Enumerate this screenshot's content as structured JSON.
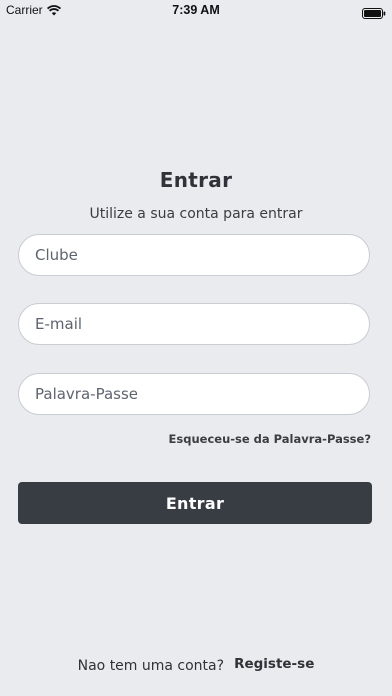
{
  "status_bar": {
    "carrier": "Carrier",
    "time": "7:39 AM",
    "icons": [
      "wifi-icon",
      "battery-icon"
    ]
  },
  "login": {
    "title": "Entrar",
    "subtitle": "Utilize a sua conta para entrar",
    "fields": {
      "clube_placeholder": "Clube",
      "email_placeholder": "E-mail",
      "password_placeholder": "Palavra-Passe"
    },
    "forgot_password": "Esqueceu-se da Palavra-Passe?",
    "submit_label": "Entrar"
  },
  "footer": {
    "prompt": "Nao tem uma conta?",
    "register_label": "Registe-se"
  },
  "colors": {
    "background": "#eaebef",
    "primary_button": "#383c43",
    "input_border": "#c9ccd3",
    "text": "#2f3238"
  }
}
